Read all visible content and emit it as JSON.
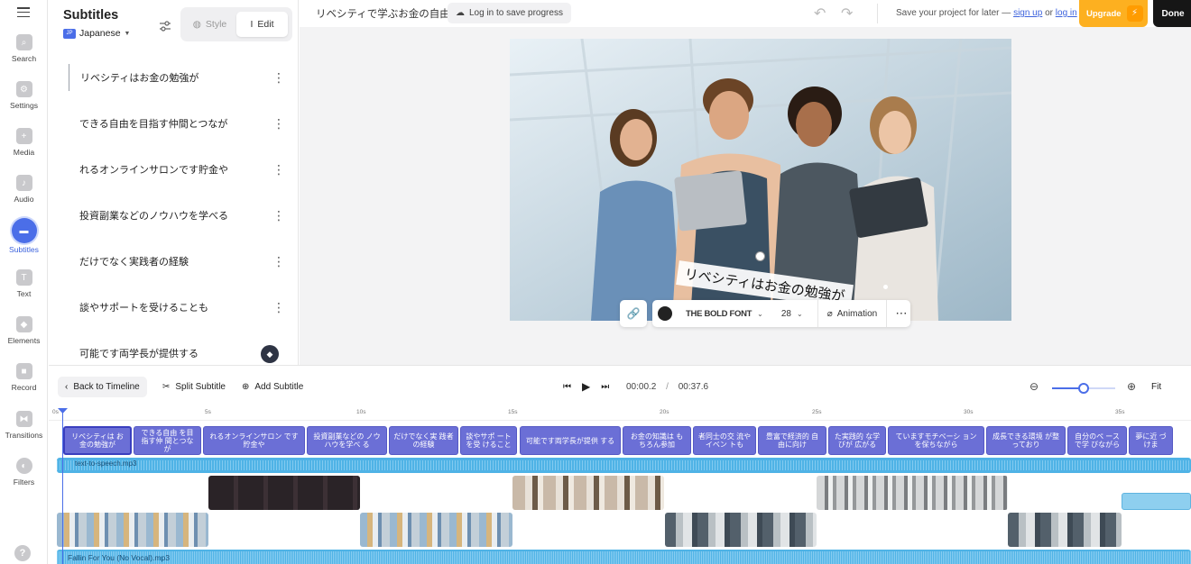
{
  "rail": {
    "items": [
      {
        "label": "Search",
        "icon": "search-icon"
      },
      {
        "label": "Settings",
        "icon": "settings-icon"
      },
      {
        "label": "Media",
        "icon": "media-icon"
      },
      {
        "label": "Audio",
        "icon": "audio-icon"
      },
      {
        "label": "Subtitles",
        "icon": "subtitles-icon"
      },
      {
        "label": "Text",
        "icon": "text-icon"
      },
      {
        "label": "Elements",
        "icon": "elements-icon"
      },
      {
        "label": "Record",
        "icon": "record-icon"
      },
      {
        "label": "Transitions",
        "icon": "transitions-icon"
      },
      {
        "label": "Filters",
        "icon": "filters-icon"
      }
    ],
    "help": "?"
  },
  "panel": {
    "title": "Subtitles",
    "language": "Japanese",
    "flag": "JP",
    "tabs": {
      "style": "Style",
      "edit": "Edit"
    },
    "subtitles": [
      "リベシティはお金の勉強が",
      "できる自由を目指す仲間とつなが",
      "れるオンラインサロンです貯金や",
      "投資副業などのノウハウを学べる",
      "だけでなく実践者の経験",
      "談やサポートを受けることも",
      "可能です両学長が提供する"
    ]
  },
  "topbar": {
    "project_title": "リベシティで学ぶお金の自由",
    "login_label": "Log in to save progress",
    "save_text": "Save your project for later —",
    "sign_up": "sign up",
    "or": "or",
    "log_in": "log in",
    "upgrade": "Upgrade",
    "done": "Done"
  },
  "canvas": {
    "caption": "リベシティはお金の勉強が",
    "font_name": "THE BOLD FONT",
    "font_size": "28",
    "animation": "Animation",
    "text_color": "#222222"
  },
  "timeline_controls": {
    "back": "Back to Timeline",
    "split": "Split Subtitle",
    "add": "Add Subtitle",
    "current_time": "00:00.2",
    "separator": "/",
    "total_time": "00:37.6",
    "fit": "Fit",
    "zoom_level": 0.5
  },
  "timeline": {
    "ruler": [
      "0s",
      "5s",
      "10s",
      "15s",
      "20s",
      "25s",
      "30s",
      "35s"
    ],
    "subtitle_clips": [
      "リベシティは お金の勉強が",
      "できる自由 を目指す仲 間とつなが",
      "れるオンラインサロン です貯金や",
      "投資副業などの ノウハウを学べ る",
      "だけでなく実 践者の経験",
      "談やサポ ートを受 けること",
      "可能です両学長が提供 する",
      "お金の知識は もちろん参加",
      "者同士の交 流やイベン トも",
      "豊富で経済的 自由に向け",
      "た実践的 な学びが 広がる",
      "ていますモチベーシ ョンを保ちながら",
      "成長できる環境 が整っており",
      "自分のペ ースで学 びながら",
      "夢に近 づけま"
    ],
    "tts_label": "text-to-speech.mp3",
    "music_label": "Fallin For You (No Vocal).mp3"
  }
}
